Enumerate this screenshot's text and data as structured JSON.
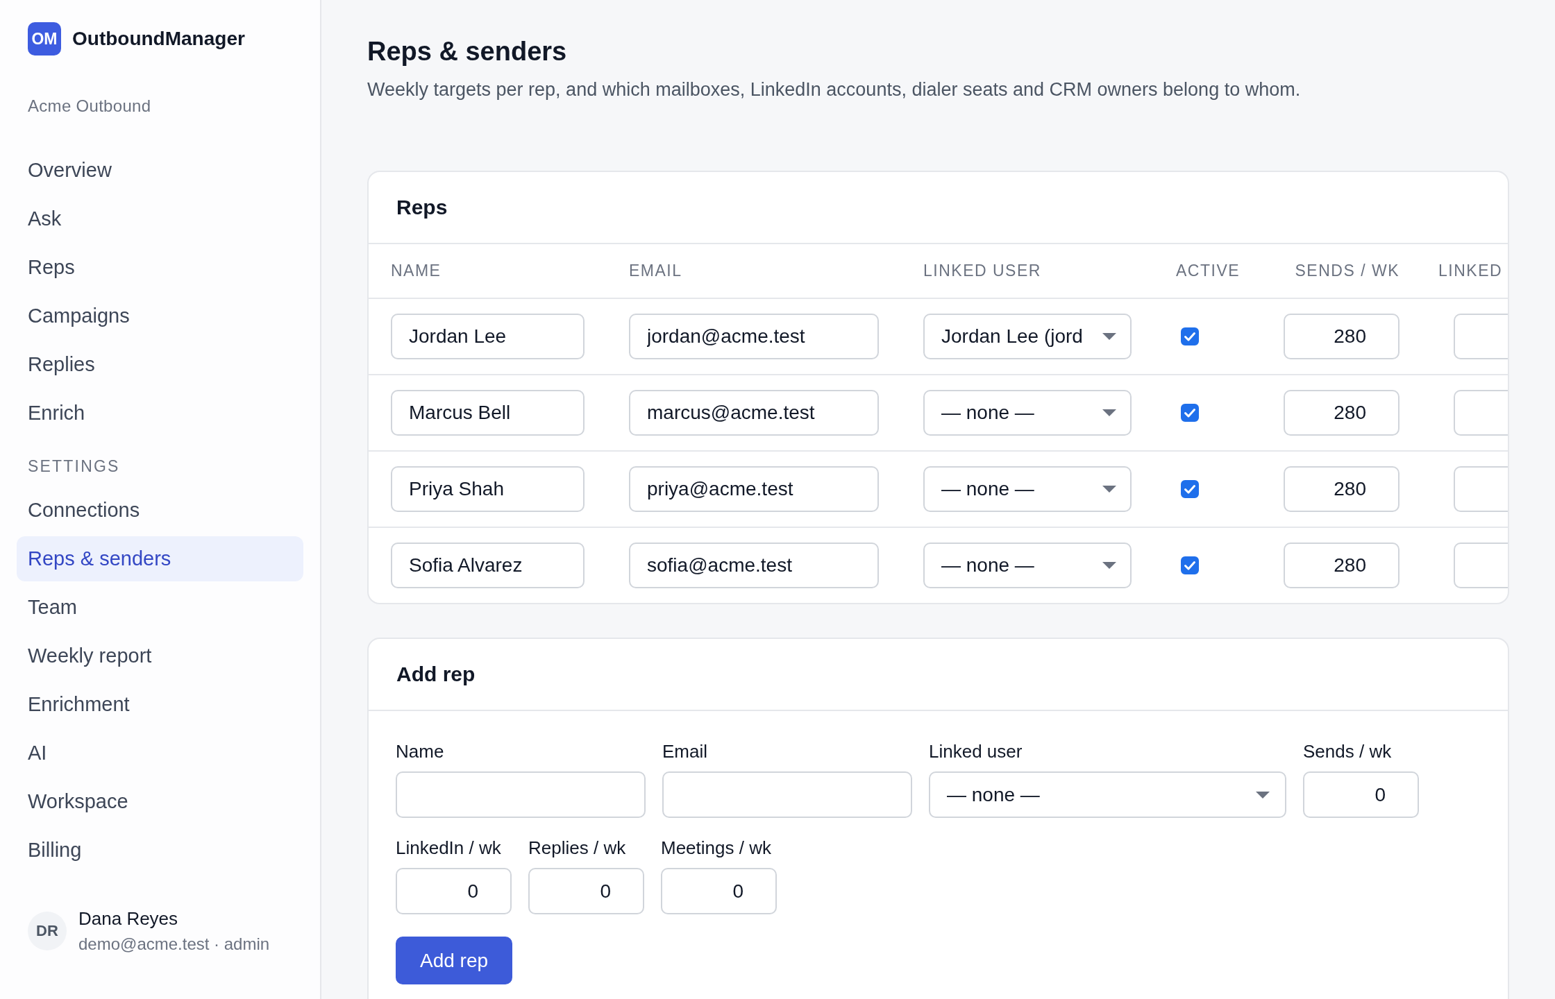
{
  "sidebar": {
    "logo": {
      "initials": "OM",
      "name": "OutboundManager"
    },
    "workspace": "Acme Outbound",
    "sections": [
      {
        "items": [
          {
            "label": "Overview",
            "selected": false
          },
          {
            "label": "Ask",
            "selected": false
          },
          {
            "label": "Reps",
            "selected": false
          },
          {
            "label": "Campaigns",
            "selected": false
          },
          {
            "label": "Replies",
            "selected": false
          },
          {
            "label": "Enrich",
            "selected": false
          }
        ]
      },
      {
        "heading": "SETTINGS",
        "items": [
          {
            "label": "Connections",
            "selected": false
          },
          {
            "label": "Reps & senders",
            "selected": true
          },
          {
            "label": "Team",
            "selected": false
          },
          {
            "label": "Weekly report",
            "selected": false
          },
          {
            "label": "Enrichment",
            "selected": false
          },
          {
            "label": "AI",
            "selected": false
          },
          {
            "label": "Workspace",
            "selected": false
          },
          {
            "label": "Billing",
            "selected": false
          }
        ]
      }
    ],
    "user": {
      "initials": "DR",
      "name": "Dana Reyes",
      "detail": "demo@acme.test · admin"
    }
  },
  "page": {
    "title": "Reps & senders",
    "subtitle": "Weekly targets per rep, and which mailboxes, LinkedIn accounts, dialer seats and CRM owners belong to whom."
  },
  "reps_table": {
    "title": "Reps",
    "columns": [
      "NAME",
      "EMAIL",
      "LINKED USER",
      "ACTIVE",
      "SENDS / WK",
      "LINKED"
    ],
    "rows": [
      {
        "name": "Jordan Lee",
        "email": "jordan@acme.test",
        "linked_user": "Jordan Lee (jord",
        "active": true,
        "sends_per_wk": "280"
      },
      {
        "name": "Marcus Bell",
        "email": "marcus@acme.test",
        "linked_user": "— none —",
        "active": true,
        "sends_per_wk": "280"
      },
      {
        "name": "Priya Shah",
        "email": "priya@acme.test",
        "linked_user": "— none —",
        "active": true,
        "sends_per_wk": "280"
      },
      {
        "name": "Sofia Alvarez",
        "email": "sofia@acme.test",
        "linked_user": "— none —",
        "active": true,
        "sends_per_wk": "280"
      }
    ]
  },
  "add_rep": {
    "title": "Add rep",
    "fields": [
      {
        "label": "Name",
        "kind": "text"
      },
      {
        "label": "Email",
        "kind": "text"
      },
      {
        "label": "Linked user",
        "kind": "select",
        "value": "— none —"
      },
      {
        "label": "Sends / wk",
        "kind": "number",
        "value": "0"
      },
      {
        "label": "LinkedIn / wk",
        "kind": "number",
        "value": "0"
      },
      {
        "label": "Replies / wk",
        "kind": "number",
        "value": "0"
      },
      {
        "label": "Meetings / wk",
        "kind": "number",
        "value": "0"
      }
    ],
    "button": "Add rep"
  }
}
